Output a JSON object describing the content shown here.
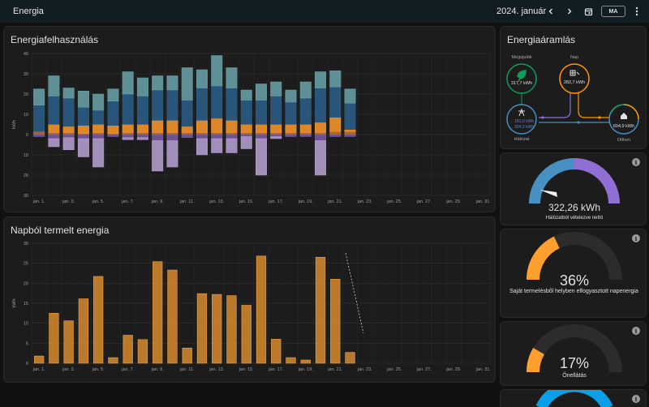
{
  "header": {
    "title": "Energia",
    "date": "2024. január",
    "today_label": "MA"
  },
  "icons": {
    "prev": "chevron-left-icon",
    "next": "chevron-right-icon",
    "calendar": "calendar-icon",
    "menu": "more-vertical-icon"
  },
  "usage_card": {
    "title": "Energiafelhasználás",
    "chart_data": {
      "type": "bar",
      "title": "Energiafelhasználás",
      "ylabel": "kWh",
      "ylim": [
        -30,
        40
      ],
      "yticks": [
        40,
        30,
        20,
        10,
        0,
        10,
        20,
        30
      ],
      "categories": [
        "jan. 1.",
        "jan. 2.",
        "jan. 3.",
        "jan. 4.",
        "jan. 5.",
        "jan. 6.",
        "jan. 7.",
        "jan. 8.",
        "jan. 9.",
        "jan. 10.",
        "jan. 11.",
        "jan. 12.",
        "jan. 13.",
        "jan. 14.",
        "jan. 15.",
        "jan. 16.",
        "jan. 17.",
        "jan. 18.",
        "jan. 19.",
        "jan. 20.",
        "jan. 21.",
        "jan. 22.",
        "jan. 23.",
        "jan. 24.",
        "jan. 25.",
        "jan. 26.",
        "jan. 27.",
        "jan. 28.",
        "jan. 29.",
        "jan. 30.",
        "jan. 31."
      ],
      "xtick_labels": [
        "jan. 1.",
        "jan. 3.",
        "jan. 5.",
        "jan. 7.",
        "jan. 9.",
        "jan. 11.",
        "jan. 13.",
        "jan. 15.",
        "jan. 17.",
        "jan. 19.",
        "jan. 21.",
        "jan. 23.",
        "jan. 25.",
        "jan. 27.",
        "jan. 29.",
        "jan. 31."
      ],
      "series": [
        {
          "values": [
            1.5,
            1,
            1,
            0.5,
            1,
            0.5,
            1,
            1,
            1,
            1,
            1,
            1,
            1,
            1,
            1,
            1,
            1,
            1,
            1,
            1,
            1.5,
            1.5,
            0,
            0,
            0,
            0,
            0,
            0,
            0,
            0,
            0
          ],
          "color": "#c8712a"
        },
        {
          "values": [
            0,
            4,
            3,
            4,
            4,
            4,
            4,
            4,
            6,
            6,
            3,
            6,
            7,
            6,
            4,
            4,
            4,
            4,
            4,
            5,
            7,
            1,
            0,
            0,
            0,
            0,
            0,
            0,
            0,
            0,
            0
          ],
          "color": "#ff9a2e"
        },
        {
          "values": [
            13,
            14,
            14,
            9,
            7,
            12,
            15,
            14,
            15,
            15,
            13,
            16,
            16,
            16,
            12,
            12,
            14,
            11,
            13,
            17,
            15,
            13,
            0,
            0,
            0,
            0,
            0,
            0,
            0,
            0,
            0
          ],
          "color": "#2a5f8a"
        },
        {
          "values": [
            8,
            10,
            5,
            8,
            8,
            6,
            11,
            9,
            7,
            7,
            16,
            9,
            15,
            10,
            5,
            8,
            7,
            6,
            8,
            8,
            8,
            7,
            0,
            0,
            0,
            0,
            0,
            0,
            0,
            0,
            0
          ],
          "color": "#6aa4aa"
        },
        {
          "values": [
            -1,
            -2,
            -1.5,
            -2,
            -2,
            -1,
            -1.5,
            -1.5,
            -3,
            -3,
            -1.5,
            -2,
            -2,
            -2,
            -1,
            -2,
            -1,
            -1,
            -1,
            -3,
            -1,
            -1,
            0,
            0,
            0,
            0,
            0,
            0,
            0,
            0,
            0
          ],
          "color": "#7b5aa8"
        },
        {
          "values": [
            0,
            -4,
            -6,
            -9,
            -14,
            0,
            -1,
            -1,
            -15,
            -13,
            0,
            -8,
            -7,
            -7,
            -6,
            -18,
            -1,
            0,
            0,
            -17,
            0,
            0,
            0,
            0,
            0,
            0,
            0,
            0,
            0,
            0,
            0
          ],
          "color": "#b9a3d6"
        }
      ]
    }
  },
  "solar_card": {
    "title": "Napból termelt energia",
    "chart_data": {
      "type": "bar",
      "title": "Napból termelt energia",
      "ylabel": "kWh",
      "ylim": [
        0,
        30
      ],
      "yticks": [
        30,
        25,
        20,
        15,
        10,
        5,
        0
      ],
      "categories": [
        "jan. 1.",
        "jan. 2.",
        "jan. 3.",
        "jan. 4.",
        "jan. 5.",
        "jan. 6.",
        "jan. 7.",
        "jan. 8.",
        "jan. 9.",
        "jan. 10.",
        "jan. 11.",
        "jan. 12.",
        "jan. 13.",
        "jan. 14.",
        "jan. 15.",
        "jan. 16.",
        "jan. 17.",
        "jan. 18.",
        "jan. 19.",
        "jan. 20.",
        "jan. 21.",
        "jan. 22.",
        "jan. 23.",
        "jan. 24.",
        "jan. 25.",
        "jan. 26.",
        "jan. 27.",
        "jan. 28.",
        "jan. 29.",
        "jan. 30.",
        "jan. 31."
      ],
      "xtick_labels": [
        "jan. 1.",
        "jan. 3.",
        "jan. 5.",
        "jan. 7.",
        "jan. 9.",
        "jan. 11.",
        "jan. 13.",
        "jan. 15.",
        "jan. 17.",
        "jan. 19.",
        "jan. 21.",
        "jan. 23.",
        "jan. 25.",
        "jan. 27.",
        "jan. 29.",
        "jan. 31."
      ],
      "values": [
        1.8,
        12.5,
        10.6,
        16.1,
        21.7,
        1.4,
        7,
        5.9,
        25.4,
        23.3,
        3.8,
        17.4,
        17.2,
        16.9,
        14.5,
        26.8,
        6,
        1.4,
        0.8,
        26.5,
        21,
        2.7,
        0,
        0,
        0,
        0,
        0,
        0,
        0,
        0,
        0
      ],
      "color": "#d68a2e"
    }
  },
  "flow_card": {
    "title": "Energiaáramlás",
    "renewable": {
      "label": "Megújulók",
      "value": "317,7 kWh",
      "color": "#0f9d58"
    },
    "solar": {
      "label": "Nap",
      "value": "282,7 kWh",
      "color": "#ff9800"
    },
    "grid": {
      "label": "Hálózat",
      "in_value": "← 181,9 kWh",
      "out_value": "→ 304,2 kWh",
      "color": "#488fc2"
    },
    "home": {
      "label": "Otthon",
      "value": "604,9 kWh",
      "color": "#ffffff"
    }
  },
  "grid_gauge": {
    "value_text": "322,26 kWh",
    "label": "Hálózatból vételezve nettó",
    "colors": [
      "#488fc2",
      "#8f6fd3"
    ]
  },
  "self_consumed_gauge": {
    "value_text": "36%",
    "fraction": 0.36,
    "label": "Saját termelésből helyben elfogyasztott napenergia",
    "color": "#ff9f2e"
  },
  "autarky_gauge": {
    "value_text": "17%",
    "fraction": 0.17,
    "label": "Önellátás",
    "color": "#ff9f2e"
  },
  "fossil_gauge": {
    "color": "#0aa0e8"
  }
}
